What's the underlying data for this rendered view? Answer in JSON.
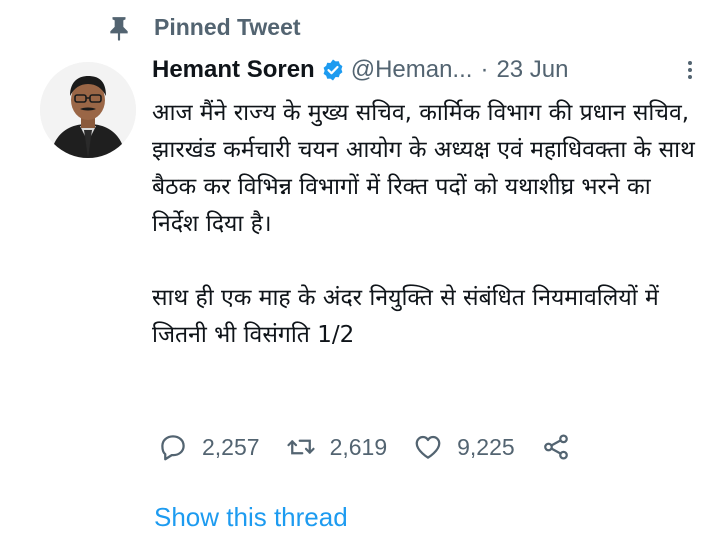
{
  "pinned": {
    "label": "Pinned Tweet",
    "icon": "pin-icon"
  },
  "tweet": {
    "author": {
      "name": "Hemant Soren",
      "handle": "@Heman...",
      "verified": true,
      "avatar_icon": "avatar"
    },
    "separator": "·",
    "date": "23 Jun",
    "text_lines": [
      "आज मैंने राज्य के मुख्य सचिव, कार्मिक विभाग की प्रधान सचिव, झारखंड कर्मचारी चयन आयोग के अध्यक्ष एवं महाधिवक्ता के साथ बैठक कर विभिन्न विभागों में रिक्त पदों को यथाशीघ्र भरने का निर्देश दिया है।",
      "साथ ही एक माह के अंदर नियुक्ति से संबंधित नियमावलियों में जितनी भी विसंगति 1/2"
    ],
    "stats": {
      "replies": "2,257",
      "retweets": "2,619",
      "likes": "9,225"
    },
    "show_thread": "Show this thread"
  },
  "colors": {
    "accent": "#1d9bf0",
    "muted": "#536471",
    "text": "#0f1419"
  }
}
